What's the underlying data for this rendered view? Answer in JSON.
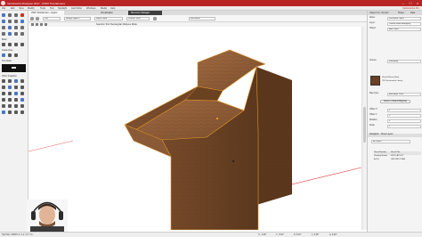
{
  "window": {
    "title": "Vectorworks Designer 2017 - [VWX Tutorial.vwx]",
    "accent": "#b92424"
  },
  "menu": {
    "items": [
      "File",
      "Edit",
      "View",
      "Modify",
      "Tools",
      "Text",
      "Spotlight",
      "AutoTurbo",
      "Windows",
      "Model",
      "Help"
    ],
    "right_label": "Vectorworks Pro"
  },
  "left_tools": {
    "snaps_label": "Basic",
    "smart_label": "Grade Note",
    "resize_label": "Trim Ratio",
    "other_label": "Other Snapshot"
  },
  "tabs": {
    "view_tab": "VWX Tutorial.vwx - Layers",
    "tab2": "Visualization",
    "tab3": "Resource Manager"
  },
  "view_bar": {
    "fields": [
      "Top",
      "Design Layer-1",
      "Layer Plane",
      "Custom View",
      "Wireframe"
    ],
    "icons": [
      "view-icon",
      "render-icon",
      "zoom-icon"
    ]
  },
  "mode_bar": {
    "message": "Selection Tool: Rectangular Marquee Mode"
  },
  "object_info": {
    "tabs": [
      "Object Info - Render",
      "Shape",
      "Data"
    ],
    "class_label": "Class:",
    "class_value": "Document Object",
    "layer_label": "Layer:",
    "layer_value": "Overall Wood Mahogany",
    "object_label": "Object:",
    "object_value": "Add Object",
    "texture_label": "Texture:",
    "texture_value": "Mahogany",
    "swatch_title": "Wood Walnut (Red)",
    "swatch_subtitle": "VW Vectorworks Library",
    "swatch_color": "#6b4024",
    "map_label": "Map Type:",
    "map_value": "Auto-Align Plane",
    "refresh_label": "Reset to Default Mapping",
    "offset_h_label": "Offset H",
    "offset_v_label": "Offset V",
    "rotation_label": "Rotation",
    "scale_label": "Scale",
    "offset_h_value": "0",
    "offset_v_value": "0",
    "rotation_value": "0",
    "scale_value": "1"
  },
  "navigation": {
    "section_title": "Navigation - Sheet Layers",
    "filter_label": "All Layers",
    "sheet_number_header": "Sheet Number",
    "sheet_title_header": "Sheet Title",
    "rows": [
      {
        "number": "Drawing Border",
        "title": "SITE LAYOUT"
      },
      {
        "number": "A-101",
        "title": "GROUND PLAN"
      }
    ]
  },
  "status": {
    "coords": "Top Plan: 48/457.3 / 1.2 / 0.7 / 0 /",
    "items": [
      "X: -1.03\"",
      "Y: -5.97\"",
      "Z: 0.00\"",
      "L: 3.25\"",
      "A: 0.00°"
    ]
  },
  "colors": {
    "wood_top": "#8a5a36",
    "wood_side": "#6e4626",
    "wood_front": "#7a4d2b",
    "selection": "#e89a2a"
  }
}
